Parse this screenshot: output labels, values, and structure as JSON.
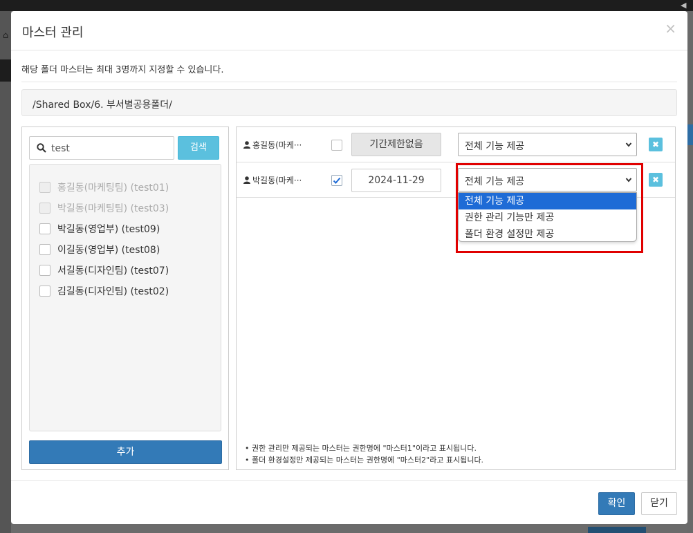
{
  "modal": {
    "title": "마스터 관리",
    "close_glyph": "×",
    "notice": "해당 폴더 마스터는 최대 3명까지 지정할 수 있습니다.",
    "path": "/Shared Box/6. 부서별공용폴더/"
  },
  "search": {
    "value": "test",
    "button_label": "검색"
  },
  "user_list": [
    {
      "label": "홍길동(마케팅팀) (test01)",
      "disabled": true
    },
    {
      "label": "박길동(마케팅팀) (test03)",
      "disabled": true
    },
    {
      "label": "박길동(영업부) (test09)",
      "disabled": false
    },
    {
      "label": "이길동(영업부) (test08)",
      "disabled": false
    },
    {
      "label": "서길동(디자인팀) (test07)",
      "disabled": false
    },
    {
      "label": "김길동(디자인팀) (test02)",
      "disabled": false
    }
  ],
  "add_button_label": "추가",
  "masters": [
    {
      "name": "홍길동(마케···",
      "period_checked": false,
      "period": "기간제한없음",
      "permission": "전체 기능 제공",
      "delete_glyph": "✖"
    },
    {
      "name": "박길동(마케···",
      "period_checked": true,
      "period": "2024-11-29",
      "permission": "전체 기능 제공",
      "delete_glyph": "✖"
    }
  ],
  "permission_options": [
    "전체 기능 제공",
    "권한 관리 기능만 제공",
    "폴더 환경 설정만 제공"
  ],
  "notes": [
    "•  권한 관리만 제공되는 마스터는 권한명에 \"마스터1\"이라고 표시됩니다.",
    "•  폴더 환경설정만 제공되는 마스터는 권한명에 \"마스터2\"라고 표시됩니다."
  ],
  "footer": {
    "ok_label": "확인",
    "close_label": "닫기"
  },
  "colors": {
    "primary": "#337ab7",
    "info": "#5bc0de",
    "highlight": "#e00000",
    "option_selected": "#1e6bd6"
  }
}
